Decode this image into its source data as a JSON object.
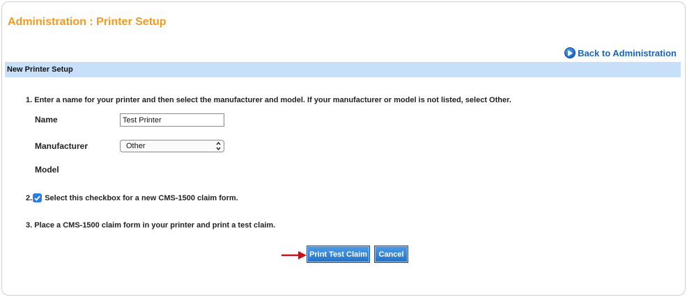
{
  "page": {
    "title": "Administration : Printer Setup",
    "back_link": "Back to Administration"
  },
  "section": {
    "title": "New Printer Setup"
  },
  "steps": {
    "step1": "1. Enter a name for your printer and then select the manufacturer and model. If your manufacturer or model is not listed, select Other.",
    "step2_number": "2.",
    "step2": "Select this checkbox for a new CMS-1500 claim form.",
    "step3": "3. Place a CMS-1500 claim form in your printer and print a test claim."
  },
  "form": {
    "name_label": "Name",
    "name_value": "Test Printer",
    "manufacturer_label": "Manufacturer",
    "manufacturer_selected": "Other",
    "model_label": "Model",
    "cms1500_checked": true
  },
  "buttons": {
    "print": "Print Test Claim",
    "cancel": "Cancel"
  },
  "colors": {
    "title": "#f39a1e",
    "link": "#1a63b7",
    "section_bar": "#c7dff8",
    "button": "#2b7de1",
    "annotation_arrow": "#c0151b"
  },
  "icons": {
    "back": "circle-play-icon",
    "checkbox": "checkmark-icon",
    "select": "updown-chevron-icon",
    "annotation": "arrow-right-icon"
  }
}
